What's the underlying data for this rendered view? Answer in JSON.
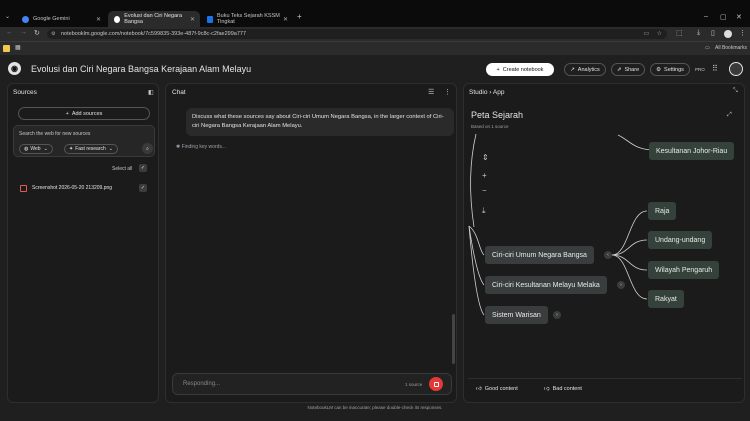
{
  "browser": {
    "tabs": [
      {
        "label": "Google Gemini",
        "color": "#4285f4"
      },
      {
        "label": "Evolusi dan Ciri Negara Bangsa",
        "color": "#ffffff"
      },
      {
        "label": "Buku Teks Sejarah KSSM Tingkat",
        "color": "#1a73e8"
      }
    ],
    "url": "notebooklm.google.com/notebook/7c599835-393e-487f-9c8c-c2fae299a777",
    "bookmarks_label": "All Bookmarks"
  },
  "app": {
    "title": "Evolusi dan Ciri Negara Bangsa Kerajaan Alam Melayu",
    "create_notebook": "Create notebook",
    "analytics": "Analytics",
    "share": "Share",
    "settings": "Settings",
    "pro": "PRO",
    "footer": "NotebookLM can be inaccurate; please double-check its responses."
  },
  "sources": {
    "title": "Sources",
    "add_sources": "Add sources",
    "search_label": "Search the web for new sources",
    "web_option": "Web",
    "research_option": "Fast research",
    "select_all": "Select all",
    "items": [
      {
        "name": "Screenshot 2026-05-20 213209.png"
      }
    ]
  },
  "chat": {
    "title": "Chat",
    "user_message": "Discuss what these sources say about Ciri-ciri Umum Negara Bangsa, in the larger context of Ciri-ciri Negara Bangsa Kerajaan Alam Melayu.",
    "status": "Finding key words...",
    "input_placeholder": "Responding...",
    "source_count": "1 source"
  },
  "studio": {
    "breadcrumb_root": "Studio",
    "breadcrumb_current": "App",
    "map_title": "Peta Sejarah",
    "map_subtitle": "Based on 1 source",
    "nodes": {
      "kesultanan": "Kesultanan Johor-Riau",
      "ciri_umum": "Ciri-ciri Umum Negara Bangsa",
      "ciri_melaka": "Ciri-ciri Kesultanan Melayu Melaka",
      "sistem": "Sistem Warisan",
      "raja": "Raja",
      "undang": "Undang-undang",
      "wilayah": "Wilayah Pengaruh",
      "rakyat": "Rakyat"
    },
    "good_content": "Good content",
    "bad_content": "Bad content"
  }
}
